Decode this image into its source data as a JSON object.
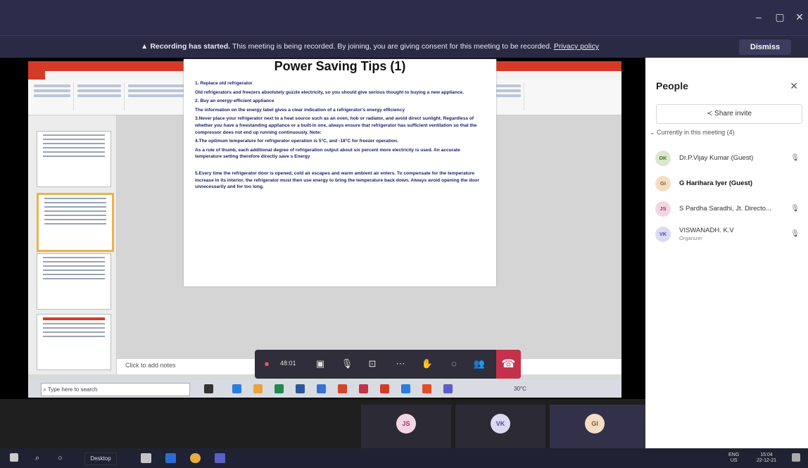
{
  "window": {
    "min_label": "–",
    "max_label": "▢",
    "close_label": "✕"
  },
  "banner": {
    "bold": "Recording has started.",
    "text": " This meeting is being recorded. By joining, you are giving consent for this meeting to be recorded. ",
    "privacy": "Privacy policy",
    "dismiss": "Dismiss"
  },
  "ppt": {
    "notes_placeholder": "Click to add notes"
  },
  "slide": {
    "title": "Power Saving Tips (1)",
    "paragraphs": [
      "1. Replace old refrigerator",
      "Old refrigerators and freezers absolutely guzzle electricity, so you should give serious thought to buying a new appliance.",
      "2. Buy an energy-efficient appliance",
      "The information on the energy label gives a clear indication of a refrigerator's energy efficiency",
      "3.Never place your refrigerator next to a heat source such as an oven, hob or radiator, and avoid direct sunlight. Regardless of whether you have a freestanding appliance or a built-in one, always ensure that refrigerator has sufficient ventilation so that the compressor does not end up running continuously. Note:",
      "4.The optimum temperature for refrigerator operation is 5°C, and -18°C for freezer operation.",
      "As a rule of thumb, each additional degree of refrigeration output about six percent more electricity is used. An accurate temperature setting therefore directly save s Energy",
      "5.Every time the refrigerator door is opened, cold air escapes and warm ambient air enters. To compensate for the temperature increase in its interior, the refrigerator must then use energy to bring the temperature back down. Always avoid opening the door unnecessarily and for too long."
    ]
  },
  "inner_taskbar": {
    "search_placeholder": "Type here to search",
    "weather": "30°C"
  },
  "controls": {
    "timer": "48:01"
  },
  "people": {
    "title": "People",
    "share_invite": "Share invite",
    "in_meeting": "Currently in this meeting (4)",
    "participants": [
      {
        "initials": "DK",
        "name": "Dr.P.Vijay Kumar (Guest)",
        "role": "",
        "avatar_bg": "#d9e8cf",
        "avatar_fg": "#4b6b2f"
      },
      {
        "initials": "GI",
        "name": "G Harihara Iyer (Guest)",
        "role": "",
        "avatar_bg": "#f3ddc4",
        "avatar_fg": "#8a5a26"
      },
      {
        "initials": "JS",
        "name": "S Pardha Saradhi, Jt. Directo...",
        "role": "",
        "avatar_bg": "#f4d6e2",
        "avatar_fg": "#a3355f"
      },
      {
        "initials": "VK",
        "name": "VISWANADH. K.V",
        "role": "Organizer",
        "avatar_bg": "#dcdaf3",
        "avatar_fg": "#4f4aa8"
      }
    ]
  },
  "tiles": [
    {
      "initials": "JS",
      "bg": "#f4d6e2",
      "fg": "#a3355f"
    },
    {
      "initials": "VK",
      "bg": "#dcdaf3",
      "fg": "#4f4aa8"
    },
    {
      "initials": "GI",
      "bg": "#f3ddc4",
      "fg": "#8a5a26"
    }
  ],
  "taskbar": {
    "desktop": "Desktop",
    "lang": "ENG\nUS",
    "time": "15:04\n22-12-21"
  }
}
